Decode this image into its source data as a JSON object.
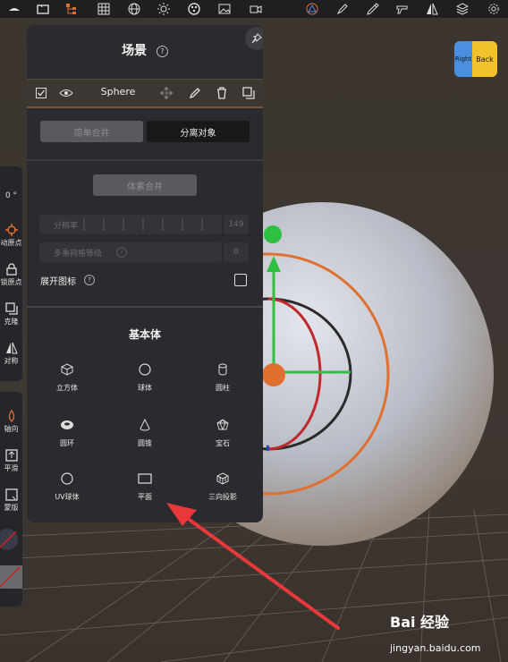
{
  "panel": {
    "title": "场景",
    "object_name": "Sphere",
    "merge_simple": "简单合并",
    "separate_objects": "分离对象",
    "voxel_merge": "体素合并",
    "resolution_label": "分辨率",
    "resolution_value": "149",
    "multires_label": "多重网格等级",
    "multires_value": "0",
    "expand_icons": "展开图标",
    "primitives_title": "基本体",
    "primitives": [
      {
        "label": "立方体",
        "icon": "cube-icon"
      },
      {
        "label": "球体",
        "icon": "sphere-icon"
      },
      {
        "label": "圆柱",
        "icon": "cylinder-icon"
      },
      {
        "label": "圆环",
        "icon": "torus-icon"
      },
      {
        "label": "圆锥",
        "icon": "cone-icon"
      },
      {
        "label": "宝石",
        "icon": "gem-icon"
      },
      {
        "label": "UV球体",
        "icon": "uv-sphere-icon"
      },
      {
        "label": "平面",
        "icon": "plane-icon"
      },
      {
        "label": "三向投影",
        "icon": "triplanar-icon"
      }
    ]
  },
  "left_tools": {
    "angle_value": "0 °",
    "move_origin": "动原点",
    "lock_origin": "锁原点",
    "clone": "克隆",
    "symmetry": "对称",
    "axis": "轴向",
    "smooth": "平滑",
    "mask": "蒙版"
  },
  "viewcube": {
    "right": "Right",
    "back": "Back"
  },
  "watermark": {
    "brand": "Bai 经验",
    "url": "jingyan.baidu.com"
  },
  "colors": {
    "accent_orange": "#e07030",
    "gizmo_green": "#2ec040",
    "gizmo_red": "#c0282c",
    "gizmo_blue": "#2040c0",
    "annotation_arrow": "#e8383a"
  }
}
